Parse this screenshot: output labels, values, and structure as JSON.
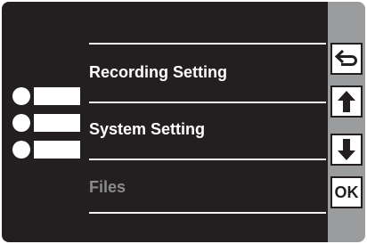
{
  "menu": {
    "items": [
      {
        "label": "Recording Setting",
        "enabled": true
      },
      {
        "label": "System Setting",
        "enabled": true
      },
      {
        "label": "Files",
        "enabled": false
      }
    ]
  },
  "side_buttons": {
    "back_icon": "return-arrow-icon",
    "up_icon": "arrow-up-icon",
    "down_icon": "arrow-down-icon",
    "ok_label": "OK"
  },
  "colors": {
    "screen_background": "#231f20",
    "sidebar_background": "#9b9c9e",
    "text_primary": "#ffffff",
    "text_disabled": "#8a8a8a"
  }
}
